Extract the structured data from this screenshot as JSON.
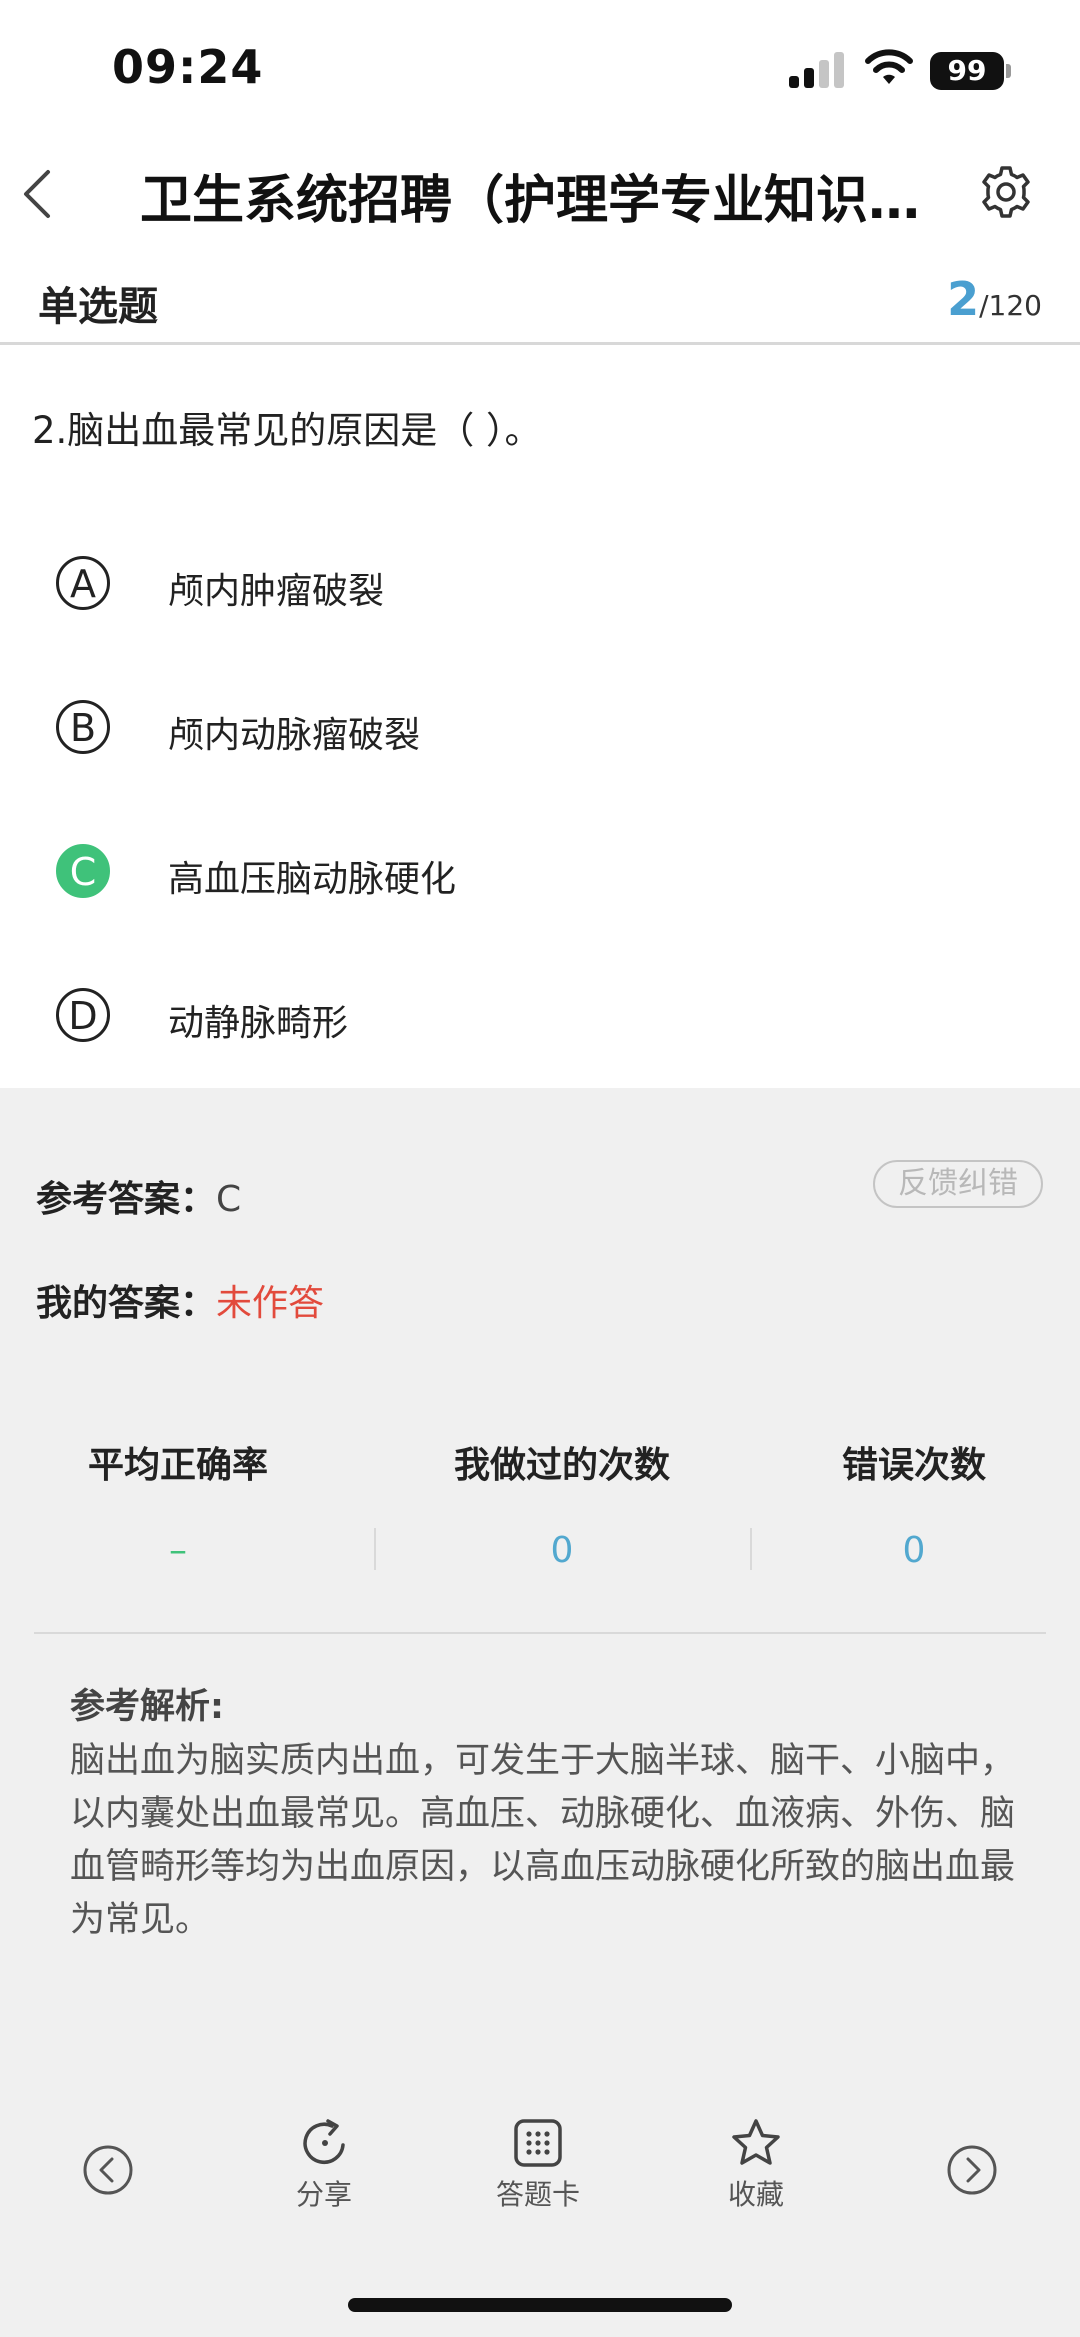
{
  "status_bar": {
    "time": "09:24",
    "battery": "99"
  },
  "header": {
    "title": "卫生系统招聘（护理学专业知识…"
  },
  "section": {
    "type_label": "单选题",
    "current": "2",
    "total": "/120"
  },
  "question": {
    "text": "2.脑出血最常见的原因是（ ）。",
    "options": [
      {
        "letter": "A",
        "text": "颅内肿瘤破裂",
        "correct": false
      },
      {
        "letter": "B",
        "text": "颅内动脉瘤破裂",
        "correct": false
      },
      {
        "letter": "C",
        "text": "高血压脑动脉硬化",
        "correct": true
      },
      {
        "letter": "D",
        "text": "动静脉畸形",
        "correct": false
      }
    ]
  },
  "answer": {
    "ref_label": "参考答案：",
    "ref_value": "C",
    "my_label": "我的答案：",
    "my_value": "未作答",
    "feedback_label": "反馈纠错"
  },
  "stats": [
    {
      "label": "平均正确率",
      "value": "–"
    },
    {
      "label": "我做过的次数",
      "value": "0"
    },
    {
      "label": "错误次数",
      "value": "0"
    }
  ],
  "analysis": {
    "title": "参考解析:",
    "text": "脑出血为脑实质内出血，可发生于大脑半球、脑干、小脑中，以内囊处出血最常见。高血压、动脉硬化、血液病、外伤、脑血管畸形等均为出血原因，以高血压动脉硬化所致的脑出血最为常见。"
  },
  "toolbar": {
    "share": "分享",
    "answer_card": "答题卡",
    "favorite": "收藏"
  },
  "colors": {
    "accent_blue": "#4a9fd0",
    "correct_green": "#3fc27a",
    "unanswered_red": "#e24a3c",
    "panel_gray": "#f0f0f0"
  },
  "icons": [
    "back-chevron-icon",
    "gear-icon",
    "prev-icon",
    "share-refresh-icon",
    "grid-icon",
    "star-icon",
    "next-icon"
  ]
}
